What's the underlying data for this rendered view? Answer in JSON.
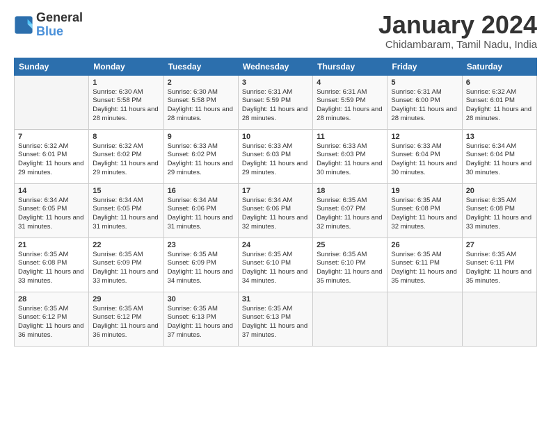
{
  "header": {
    "logo_line1": "General",
    "logo_line2": "Blue",
    "month_title": "January 2024",
    "location": "Chidambaram, Tamil Nadu, India"
  },
  "days_of_week": [
    "Sunday",
    "Monday",
    "Tuesday",
    "Wednesday",
    "Thursday",
    "Friday",
    "Saturday"
  ],
  "weeks": [
    [
      {
        "day": "",
        "info": ""
      },
      {
        "day": "1",
        "info": "Sunrise: 6:30 AM\nSunset: 5:58 PM\nDaylight: 11 hours\nand 28 minutes."
      },
      {
        "day": "2",
        "info": "Sunrise: 6:30 AM\nSunset: 5:58 PM\nDaylight: 11 hours\nand 28 minutes."
      },
      {
        "day": "3",
        "info": "Sunrise: 6:31 AM\nSunset: 5:59 PM\nDaylight: 11 hours\nand 28 minutes."
      },
      {
        "day": "4",
        "info": "Sunrise: 6:31 AM\nSunset: 5:59 PM\nDaylight: 11 hours\nand 28 minutes."
      },
      {
        "day": "5",
        "info": "Sunrise: 6:31 AM\nSunset: 6:00 PM\nDaylight: 11 hours\nand 28 minutes."
      },
      {
        "day": "6",
        "info": "Sunrise: 6:32 AM\nSunset: 6:01 PM\nDaylight: 11 hours\nand 28 minutes."
      }
    ],
    [
      {
        "day": "7",
        "info": "Sunrise: 6:32 AM\nSunset: 6:01 PM\nDaylight: 11 hours\nand 29 minutes."
      },
      {
        "day": "8",
        "info": "Sunrise: 6:32 AM\nSunset: 6:02 PM\nDaylight: 11 hours\nand 29 minutes."
      },
      {
        "day": "9",
        "info": "Sunrise: 6:33 AM\nSunset: 6:02 PM\nDaylight: 11 hours\nand 29 minutes."
      },
      {
        "day": "10",
        "info": "Sunrise: 6:33 AM\nSunset: 6:03 PM\nDaylight: 11 hours\nand 29 minutes."
      },
      {
        "day": "11",
        "info": "Sunrise: 6:33 AM\nSunset: 6:03 PM\nDaylight: 11 hours\nand 30 minutes."
      },
      {
        "day": "12",
        "info": "Sunrise: 6:33 AM\nSunset: 6:04 PM\nDaylight: 11 hours\nand 30 minutes."
      },
      {
        "day": "13",
        "info": "Sunrise: 6:34 AM\nSunset: 6:04 PM\nDaylight: 11 hours\nand 30 minutes."
      }
    ],
    [
      {
        "day": "14",
        "info": "Sunrise: 6:34 AM\nSunset: 6:05 PM\nDaylight: 11 hours\nand 31 minutes."
      },
      {
        "day": "15",
        "info": "Sunrise: 6:34 AM\nSunset: 6:05 PM\nDaylight: 11 hours\nand 31 minutes."
      },
      {
        "day": "16",
        "info": "Sunrise: 6:34 AM\nSunset: 6:06 PM\nDaylight: 11 hours\nand 31 minutes."
      },
      {
        "day": "17",
        "info": "Sunrise: 6:34 AM\nSunset: 6:06 PM\nDaylight: 11 hours\nand 32 minutes."
      },
      {
        "day": "18",
        "info": "Sunrise: 6:35 AM\nSunset: 6:07 PM\nDaylight: 11 hours\nand 32 minutes."
      },
      {
        "day": "19",
        "info": "Sunrise: 6:35 AM\nSunset: 6:08 PM\nDaylight: 11 hours\nand 32 minutes."
      },
      {
        "day": "20",
        "info": "Sunrise: 6:35 AM\nSunset: 6:08 PM\nDaylight: 11 hours\nand 33 minutes."
      }
    ],
    [
      {
        "day": "21",
        "info": "Sunrise: 6:35 AM\nSunset: 6:08 PM\nDaylight: 11 hours\nand 33 minutes."
      },
      {
        "day": "22",
        "info": "Sunrise: 6:35 AM\nSunset: 6:09 PM\nDaylight: 11 hours\nand 33 minutes."
      },
      {
        "day": "23",
        "info": "Sunrise: 6:35 AM\nSunset: 6:09 PM\nDaylight: 11 hours\nand 34 minutes."
      },
      {
        "day": "24",
        "info": "Sunrise: 6:35 AM\nSunset: 6:10 PM\nDaylight: 11 hours\nand 34 minutes."
      },
      {
        "day": "25",
        "info": "Sunrise: 6:35 AM\nSunset: 6:10 PM\nDaylight: 11 hours\nand 35 minutes."
      },
      {
        "day": "26",
        "info": "Sunrise: 6:35 AM\nSunset: 6:11 PM\nDaylight: 11 hours\nand 35 minutes."
      },
      {
        "day": "27",
        "info": "Sunrise: 6:35 AM\nSunset: 6:11 PM\nDaylight: 11 hours\nand 35 minutes."
      }
    ],
    [
      {
        "day": "28",
        "info": "Sunrise: 6:35 AM\nSunset: 6:12 PM\nDaylight: 11 hours\nand 36 minutes."
      },
      {
        "day": "29",
        "info": "Sunrise: 6:35 AM\nSunset: 6:12 PM\nDaylight: 11 hours\nand 36 minutes."
      },
      {
        "day": "30",
        "info": "Sunrise: 6:35 AM\nSunset: 6:13 PM\nDaylight: 11 hours\nand 37 minutes."
      },
      {
        "day": "31",
        "info": "Sunrise: 6:35 AM\nSunset: 6:13 PM\nDaylight: 11 hours\nand 37 minutes."
      },
      {
        "day": "",
        "info": ""
      },
      {
        "day": "",
        "info": ""
      },
      {
        "day": "",
        "info": ""
      }
    ]
  ]
}
